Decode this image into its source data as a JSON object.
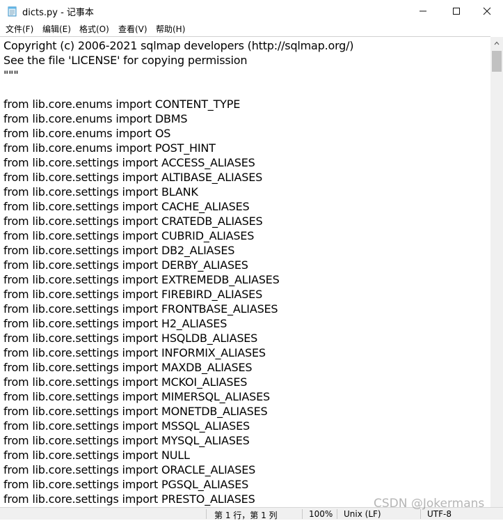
{
  "titlebar": {
    "title": "dicts.py - 记事本",
    "icon": "notepad-icon"
  },
  "menu": [
    {
      "label": "文件(F)"
    },
    {
      "label": "编辑(E)"
    },
    {
      "label": "格式(O)"
    },
    {
      "label": "查看(V)"
    },
    {
      "label": "帮助(H)"
    }
  ],
  "editor": {
    "lines": [
      "Copyright (c) 2006-2021 sqlmap developers (http://sqlmap.org/)",
      "See the file 'LICENSE' for copying permission",
      "\"\"\"",
      "",
      "from lib.core.enums import CONTENT_TYPE",
      "from lib.core.enums import DBMS",
      "from lib.core.enums import OS",
      "from lib.core.enums import POST_HINT",
      "from lib.core.settings import ACCESS_ALIASES",
      "from lib.core.settings import ALTIBASE_ALIASES",
      "from lib.core.settings import BLANK",
      "from lib.core.settings import CACHE_ALIASES",
      "from lib.core.settings import CRATEDB_ALIASES",
      "from lib.core.settings import CUBRID_ALIASES",
      "from lib.core.settings import DB2_ALIASES",
      "from lib.core.settings import DERBY_ALIASES",
      "from lib.core.settings import EXTREMEDB_ALIASES",
      "from lib.core.settings import FIREBIRD_ALIASES",
      "from lib.core.settings import FRONTBASE_ALIASES",
      "from lib.core.settings import H2_ALIASES",
      "from lib.core.settings import HSQLDB_ALIASES",
      "from lib.core.settings import INFORMIX_ALIASES",
      "from lib.core.settings import MAXDB_ALIASES",
      "from lib.core.settings import MCKOI_ALIASES",
      "from lib.core.settings import MIMERSQL_ALIASES",
      "from lib.core.settings import MONETDB_ALIASES",
      "from lib.core.settings import MSSQL_ALIASES",
      "from lib.core.settings import MYSQL_ALIASES",
      "from lib.core.settings import NULL",
      "from lib.core.settings import ORACLE_ALIASES",
      "from lib.core.settings import PGSQL_ALIASES",
      "from lib.core.settings import PRESTO_ALIASES"
    ]
  },
  "status": {
    "position": "第 1 行，第 1 列",
    "zoom": "100%",
    "line_ending": "Unix (LF)",
    "encoding": "UTF-8"
  },
  "watermark": "CSDN @Jokermans"
}
